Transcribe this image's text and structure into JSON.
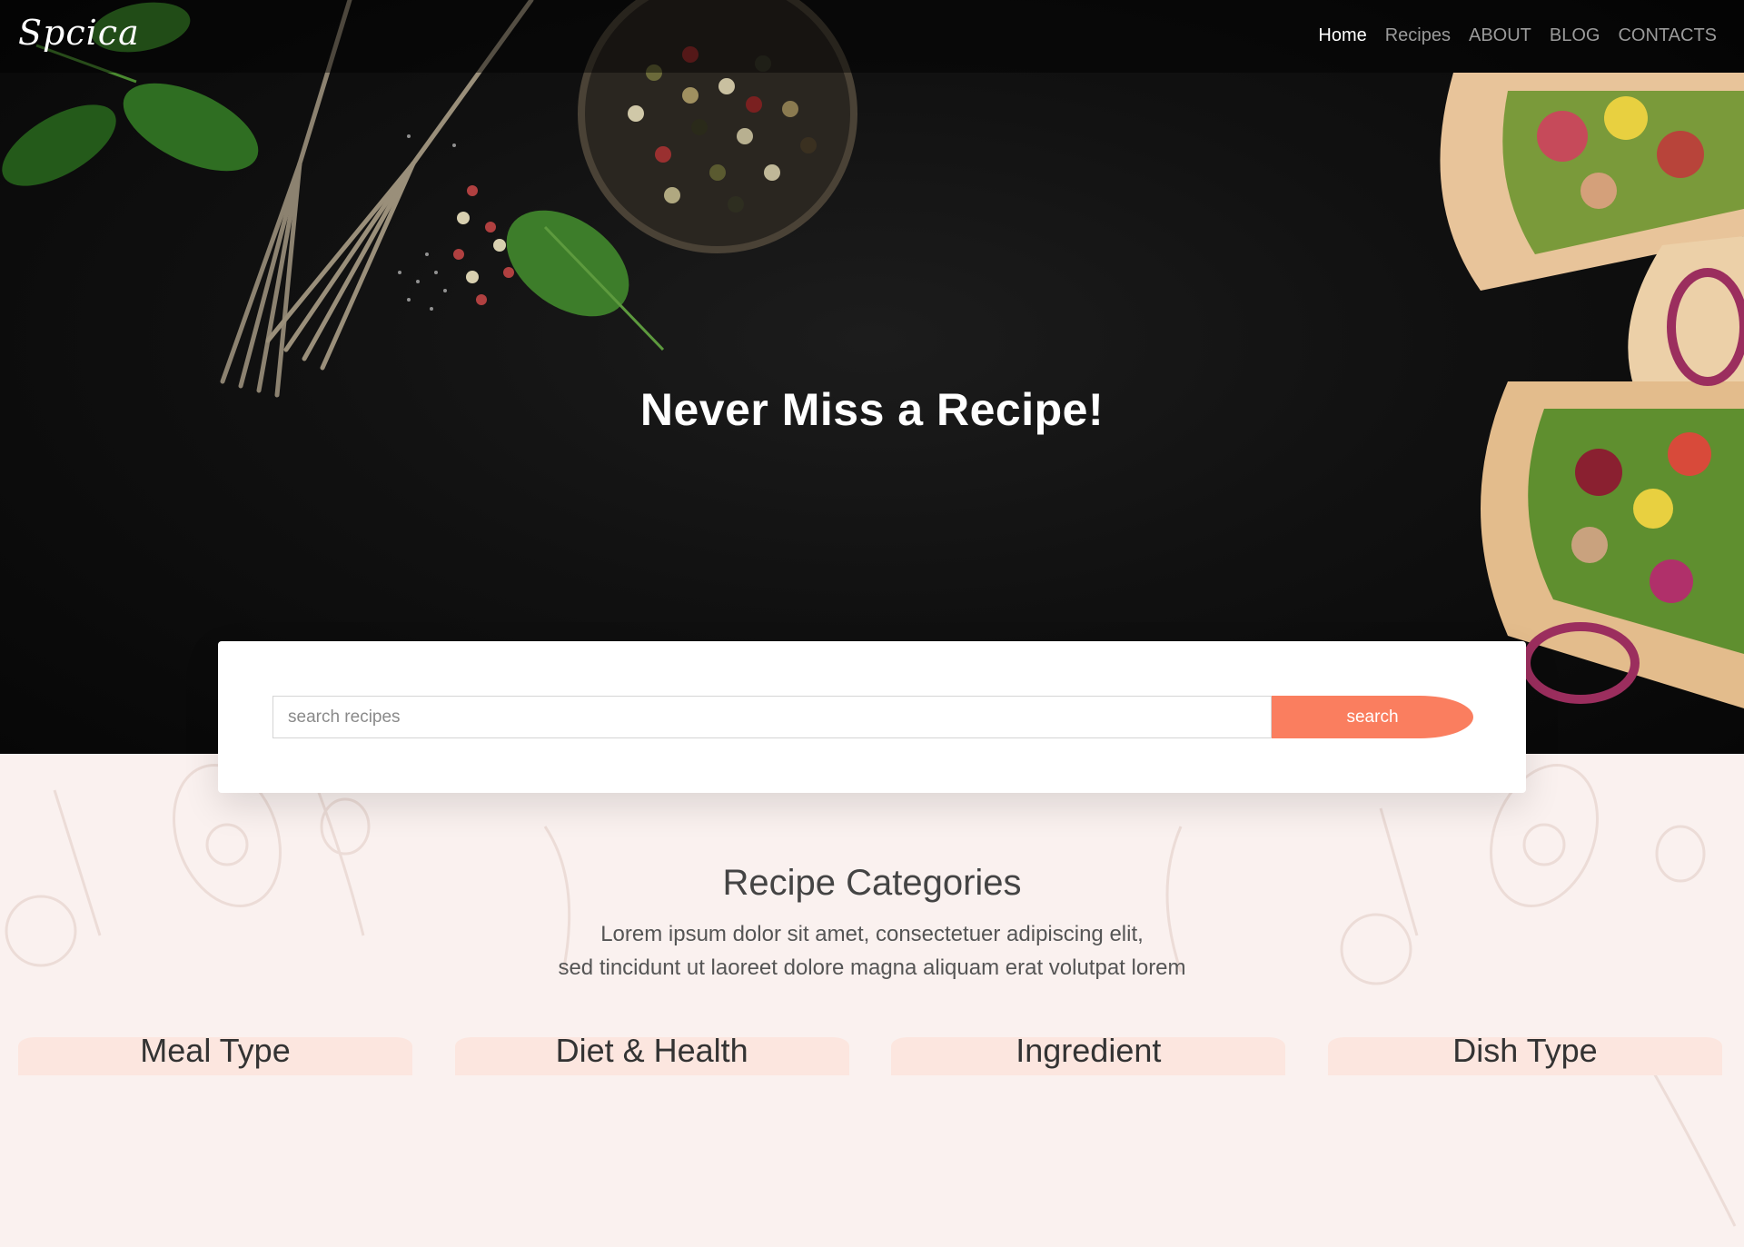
{
  "brand": {
    "logo": "Spcica"
  },
  "nav": {
    "items": [
      {
        "label": "Home",
        "active": true
      },
      {
        "label": "Recipes",
        "active": false
      },
      {
        "label": "ABOUT",
        "active": false
      },
      {
        "label": "BLOG",
        "active": false
      },
      {
        "label": "CONTACTS",
        "active": false
      }
    ]
  },
  "hero": {
    "title": "Never Miss a Recipe!"
  },
  "search": {
    "placeholder": "search recipes",
    "value": "",
    "button_label": "search"
  },
  "categories_section": {
    "title": "Recipe Categories",
    "desc_line1": "Lorem ipsum dolor sit amet, consectetuer adipiscing elit,",
    "desc_line2": "sed tincidunt ut laoreet dolore magna aliquam erat volutpat lorem",
    "tabs": [
      "Meal Type",
      "Diet & Health",
      "Ingredient",
      "Dish Type"
    ]
  },
  "colors": {
    "accent": "#fa7e5f",
    "tab_bg": "#fce6df",
    "page_bg": "#faf1ef",
    "hero_bg": "#111111"
  }
}
